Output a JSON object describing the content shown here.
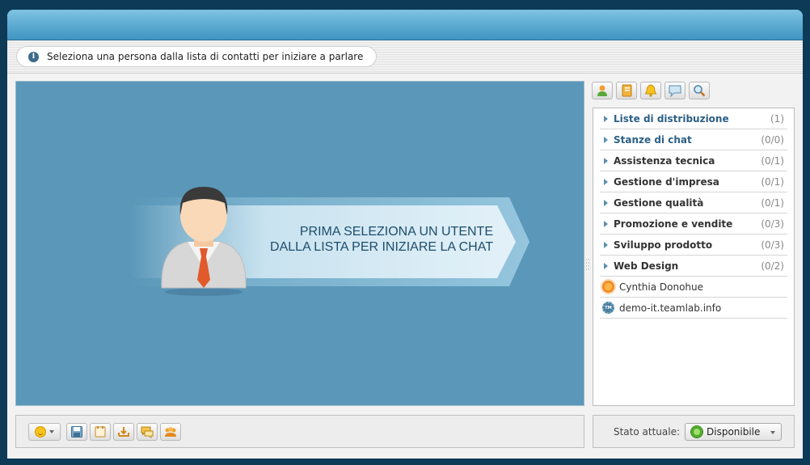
{
  "info_tab": {
    "icon": "info-icon",
    "text": "Seleziona una persona dalla lista di contatti per iniziare a parlare"
  },
  "chat_area": {
    "banner_line1": "PRIMA SELEZIONA UN UTENTE",
    "banner_line2": "DALLA LISTA PER INIZIARE LA CHAT",
    "background_color": "#5a97b8"
  },
  "side_toolbar": {
    "buttons": [
      {
        "icon": "contacts-icon"
      },
      {
        "icon": "address-book-icon"
      },
      {
        "icon": "bell-icon"
      },
      {
        "icon": "chat-bubble-icon"
      },
      {
        "icon": "search-icon"
      }
    ]
  },
  "contacts": {
    "groups": [
      {
        "name": "Liste di distribuzione",
        "count": "(1)"
      },
      {
        "name": "Stanze di chat",
        "count": "(0/0)"
      },
      {
        "name": "Assistenza tecnica",
        "count": "(0/1)"
      },
      {
        "name": "Gestione d'impresa",
        "count": "(0/1)"
      },
      {
        "name": "Gestione qualità",
        "count": "(0/1)"
      },
      {
        "name": "Promozione e vendite",
        "count": "(0/3)"
      },
      {
        "name": "Sviluppo prodotto",
        "count": "(0/3)"
      },
      {
        "name": "Web Design",
        "count": "(0/2)"
      }
    ],
    "people": [
      {
        "name": "Cynthia Donohue",
        "icon": "away-status-icon"
      },
      {
        "name": "demo-it.teamlab.info",
        "icon": "server-icon",
        "icon_text": "TM"
      }
    ]
  },
  "bottom_toolbar": {
    "buttons": [
      {
        "icon": "save-icon"
      },
      {
        "icon": "history-icon"
      },
      {
        "icon": "send-file-icon"
      },
      {
        "icon": "messages-icon"
      },
      {
        "icon": "conference-icon"
      }
    ]
  },
  "status": {
    "label": "Stato attuale:",
    "value": "Disponibile",
    "color": "#4fa82a"
  }
}
